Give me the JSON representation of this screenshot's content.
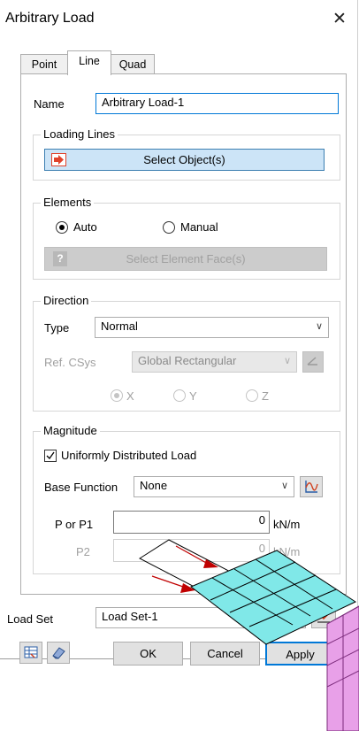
{
  "window": {
    "title": "Arbitrary Load",
    "close_glyph": "✕"
  },
  "tabs": [
    {
      "label": "Point"
    },
    {
      "label": "Line"
    },
    {
      "label": "Quad"
    }
  ],
  "name": {
    "label": "Name",
    "value": "Arbitrary Load-1"
  },
  "loading_lines": {
    "title": "Loading Lines",
    "select_button": "Select Object(s)"
  },
  "elements": {
    "title": "Elements",
    "auto": "Auto",
    "manual": "Manual",
    "select_face_button": "Select Element Face(s)",
    "selected": "Auto"
  },
  "direction": {
    "title": "Direction",
    "type_label": "Type",
    "type_value": "Normal",
    "ref_csys_label": "Ref. CSys",
    "ref_csys_value": "Global Rectangular",
    "x": "X",
    "y": "Y",
    "z": "Z",
    "selected_axis": "X"
  },
  "magnitude": {
    "title": "Magnitude",
    "uniform_label": "Uniformly Distributed Load",
    "uniform_checked": true,
    "base_function_label": "Base Function",
    "base_function_value": "None",
    "p1_label": "P or P1",
    "p1_value": "0",
    "p1_unit": "kN/m",
    "p2_label": "P2",
    "p2_value": "0",
    "p2_unit": "kN/m"
  },
  "load_set": {
    "label": "Load Set",
    "value": "Load Set-1"
  },
  "footer": {
    "ok": "OK",
    "cancel": "Cancel",
    "apply": "Apply"
  },
  "colors": {
    "accent": "#0078d7",
    "select_button_bg": "#cce4f7",
    "mesh_fill": "#80e8e8",
    "solid_fill": "#e8a0e8"
  }
}
